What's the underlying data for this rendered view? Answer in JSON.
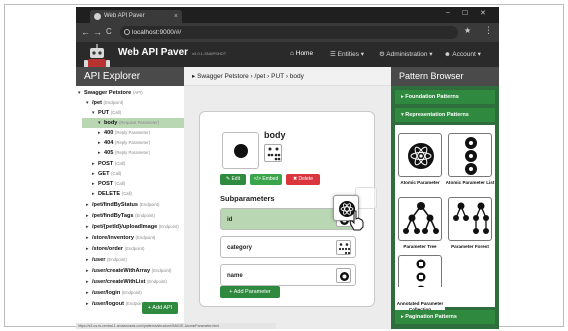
{
  "browser": {
    "tab_title": "Web API Paver",
    "tab_close": "×",
    "url": "localhost:9000/#/",
    "win_min": "–",
    "win_max": "☐",
    "win_close": "✕",
    "back": "←",
    "forward": "→",
    "reload": "C",
    "bookmark": "★",
    "menu": "⋮",
    "status_url": "https://s3-us-ts-central-1.amazonaws.com/patterns/structure/IMAGE-AtomicParameter.html"
  },
  "app": {
    "brand": "Web API Paver",
    "version": "v0.0.1-SNAPSHOT",
    "nav": [
      {
        "icon": "home-icon",
        "label": "Home"
      },
      {
        "icon": "list-icon",
        "label": "Entities ▾"
      },
      {
        "icon": "gear-icon",
        "label": "Administration ▾"
      },
      {
        "icon": "user-icon",
        "label": "Account ▾"
      }
    ]
  },
  "explorer": {
    "title": "API Explorer",
    "add_label": "+ Add API",
    "items": [
      {
        "label": "Swagger Petstore",
        "sub": "(API)",
        "indent": 0,
        "caret": "▾",
        "selected": false
      },
      {
        "label": "/pet",
        "sub": "(Endpoint)",
        "indent": 1,
        "caret": "▾",
        "selected": false
      },
      {
        "label": "PUT",
        "sub": "(Call)",
        "indent": 2,
        "caret": "▾",
        "selected": false
      },
      {
        "label": "body",
        "sub": "(Request Parameter)",
        "indent": 3,
        "caret": "▾",
        "selected": true
      },
      {
        "label": "400",
        "sub": "(Reply Parameter)",
        "indent": 3,
        "caret": "▸",
        "selected": false
      },
      {
        "label": "404",
        "sub": "(Reply Parameter)",
        "indent": 3,
        "caret": "▸",
        "selected": false
      },
      {
        "label": "405",
        "sub": "(Reply Parameter)",
        "indent": 3,
        "caret": "▸",
        "selected": false
      },
      {
        "label": "POST",
        "sub": "(Call)",
        "indent": 2,
        "caret": "▸",
        "selected": false
      },
      {
        "label": "GET",
        "sub": "(Call)",
        "indent": 2,
        "caret": "▸",
        "selected": false
      },
      {
        "label": "POST",
        "sub": "(Call)",
        "indent": 2,
        "caret": "▸",
        "selected": false
      },
      {
        "label": "DELETE",
        "sub": "(Call)",
        "indent": 2,
        "caret": "▸",
        "selected": false
      },
      {
        "label": "/pet/findByStatus",
        "sub": "(Endpoint)",
        "indent": 1,
        "caret": "▸",
        "selected": false
      },
      {
        "label": "/pet/findByTags",
        "sub": "(Endpoint)",
        "indent": 1,
        "caret": "▸",
        "selected": false
      },
      {
        "label": "/pet/{petId}/uploadImage",
        "sub": "(Endpoint)",
        "indent": 1,
        "caret": "▸",
        "selected": false
      },
      {
        "label": "/store/inventory",
        "sub": "(Endpoint)",
        "indent": 1,
        "caret": "▸",
        "selected": false
      },
      {
        "label": "/store/order",
        "sub": "(Endpoint)",
        "indent": 1,
        "caret": "▸",
        "selected": false
      },
      {
        "label": "/user",
        "sub": "(Endpoint)",
        "indent": 1,
        "caret": "▸",
        "selected": false
      },
      {
        "label": "/user/createWithArray",
        "sub": "(Endpoint)",
        "indent": 1,
        "caret": "▸",
        "selected": false
      },
      {
        "label": "/user/createWithList",
        "sub": "(Endpoint)",
        "indent": 1,
        "caret": "▸",
        "selected": false
      },
      {
        "label": "/user/login",
        "sub": "(Endpoint)",
        "indent": 1,
        "caret": "▸",
        "selected": false
      },
      {
        "label": "/user/logout",
        "sub": "(Endpoint)",
        "indent": 1,
        "caret": "▸",
        "selected": false
      }
    ]
  },
  "breadcrumb": {
    "text": "▸ Swagger Petstore › /pet › PUT › body"
  },
  "editor": {
    "title": "body",
    "edit_label": "✎ Edit",
    "embed_label": "</> Embed",
    "delete_label": "✖ Delete",
    "subparams_title": "Subparameters",
    "params": [
      {
        "name": "id",
        "active": true,
        "icon": "atom-icon"
      },
      {
        "name": "category",
        "active": false,
        "icon": "forest-icon"
      },
      {
        "name": "name",
        "active": false,
        "icon": "atom-icon"
      }
    ],
    "add_param_label": "+ Add Parameter"
  },
  "patterns": {
    "title": "Pattern Browser",
    "sections": [
      {
        "label": "▸ Foundation Patterns"
      },
      {
        "label": "▾ Representation Patterns"
      },
      {
        "label": "▸ Pagination Patterns"
      }
    ],
    "cards": [
      {
        "label": "Atomic Parameter",
        "icon": "atom-icon"
      },
      {
        "label": "Atomic Parameter List",
        "icon": "atom-list-icon"
      },
      {
        "label": "Parameter Tree",
        "icon": "tree-icon"
      },
      {
        "label": "Parameter Forest",
        "icon": "forest-icon"
      },
      {
        "label": "Annotated Parameter Collection",
        "icon": "annotated-collection-icon"
      }
    ]
  },
  "colors": {
    "accent_green": "#2f8a3f",
    "selected_green": "#b9d7b3",
    "delete_red": "#d9363e",
    "embed_green": "#3aa54a",
    "dark_header": "#4a4a4a"
  }
}
